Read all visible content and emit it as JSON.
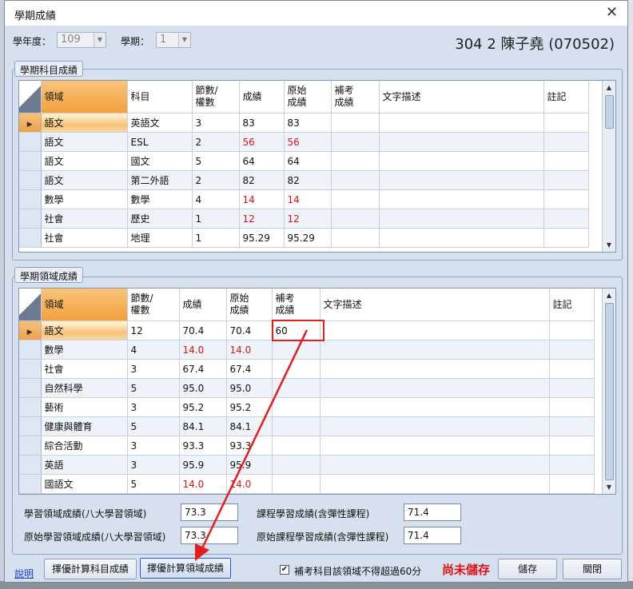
{
  "window": {
    "title": "學期成績",
    "close_icon": "close-icon"
  },
  "filters": {
    "year_label": "學年度：",
    "year_value": "109",
    "semester_label": "學期：",
    "semester_value": "1"
  },
  "student": "304 2 陳子堯 (070502)",
  "subject_section": {
    "title": "學期科目成績",
    "headers": [
      "領域",
      "科目",
      "節數/\n權數",
      "成績",
      "原始\n成績",
      "補考\n成績",
      "文字描述",
      "註記"
    ],
    "rows": [
      [
        "語文",
        "英語文",
        "3",
        "83",
        "83",
        "",
        "",
        ""
      ],
      [
        "語文",
        "ESL",
        "2",
        "56",
        "56",
        "",
        "",
        ""
      ],
      [
        "語文",
        "國文",
        "5",
        "64",
        "64",
        "",
        "",
        ""
      ],
      [
        "語文",
        "第二外語",
        "2",
        "82",
        "82",
        "",
        "",
        ""
      ],
      [
        "數學",
        "數學",
        "4",
        "14",
        "14",
        "",
        "",
        ""
      ],
      [
        "社會",
        "歷史",
        "1",
        "12",
        "12",
        "",
        "",
        ""
      ],
      [
        "社會",
        "地理",
        "1",
        "95.29",
        "95.29",
        "",
        "",
        ""
      ]
    ],
    "red_rows": [
      1,
      4,
      5
    ]
  },
  "domain_section": {
    "title": "學期領域成績",
    "headers": [
      "領域",
      "節數/\n權數",
      "成績",
      "原始\n成績",
      "補考\n成績",
      "文字描述",
      "註記"
    ],
    "rows": [
      [
        "語文",
        "12",
        "70.4",
        "70.4",
        "60",
        "",
        ""
      ],
      [
        "數學",
        "4",
        "14.0",
        "14.0",
        "",
        "",
        ""
      ],
      [
        "社會",
        "3",
        "67.4",
        "67.4",
        "",
        "",
        ""
      ],
      [
        "自然科學",
        "5",
        "95.0",
        "95.0",
        "",
        "",
        ""
      ],
      [
        "藝術",
        "3",
        "95.2",
        "95.2",
        "",
        "",
        ""
      ],
      [
        "健康與體育",
        "5",
        "84.1",
        "84.1",
        "",
        "",
        ""
      ],
      [
        "綜合活動",
        "3",
        "93.3",
        "93.3",
        "",
        "",
        ""
      ],
      [
        "英語",
        "3",
        "95.9",
        "95.9",
        "",
        "",
        ""
      ],
      [
        "國語文",
        "5",
        "14.0",
        "14.0",
        "",
        "",
        ""
      ]
    ],
    "red_rows": [
      1,
      8
    ]
  },
  "summary": {
    "learning_domain_label": "學習領域成績(八大學習領域)",
    "learning_domain_value": "73.3",
    "raw_learning_domain_label": "原始學習領域成績(八大學習領域)",
    "raw_learning_domain_value": "73.3",
    "course_label": "課程學習成績(含彈性課程)",
    "course_value": "71.4",
    "raw_course_label": "原始課程學習成績(含彈性課程)",
    "raw_course_value": "71.4"
  },
  "footer": {
    "help_link": "說明",
    "calc_subject_button": "擇優計算科目成績",
    "calc_domain_button": "擇優計算領域成績",
    "checkbox_label": "補考科目該領域不得超過60分",
    "checkbox_checked": true,
    "unsaved_text": "尚未儲存",
    "save_button": "儲存",
    "close_button": "關閉"
  },
  "colors": {
    "accent_orange": "#f3a03b",
    "alert_red": "#e01010",
    "annotation_red": "#e51d1d"
  }
}
